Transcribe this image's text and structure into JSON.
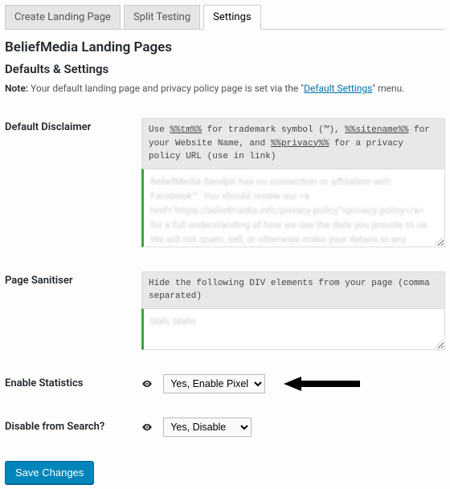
{
  "tabs": {
    "create": "Create Landing Page",
    "split": "Split Testing",
    "settings": "Settings"
  },
  "heading": "BeliefMedia Landing Pages",
  "subheading": "Defaults & Settings",
  "note": {
    "label": "Note:",
    "before": " Your default landing page and privacy policy page is set via the \"",
    "link": "Default Settings",
    "after": "\" menu."
  },
  "rows": {
    "disclaimer": {
      "label": "Default Disclaimer",
      "hint_parts": {
        "p1": "Use ",
        "t1": "%%tm%%",
        "p2": " for trademark symbol (™), ",
        "t2": "%%sitename%%",
        "p3": " for your Website Name, and ",
        "t3": "%%privacy%%",
        "p4": " for a privacy policy URL (use in link)"
      },
      "blur": "BeliefMedia Sandpit has no connection or affiliation with Facebook™. You should review our <a href=\"https://beliefmedia.info/privacy-policy\">privacy policy</a> for a full understanding of how we use the data you provide to us. We will not spam, sell, or otherwise make your details to any individual under any circumstances."
    },
    "sanitiser": {
      "label": "Page Sanitiser",
      "hint": "Hide the following DIV elements from your page (comma separated)",
      "blur": "blah, blahs"
    },
    "stats": {
      "label": "Enable Statistics",
      "value": "Yes, Enable Pixel"
    },
    "search": {
      "label": "Disable from Search?",
      "value": "Yes, Disable"
    }
  },
  "save_button": "Save Changes"
}
